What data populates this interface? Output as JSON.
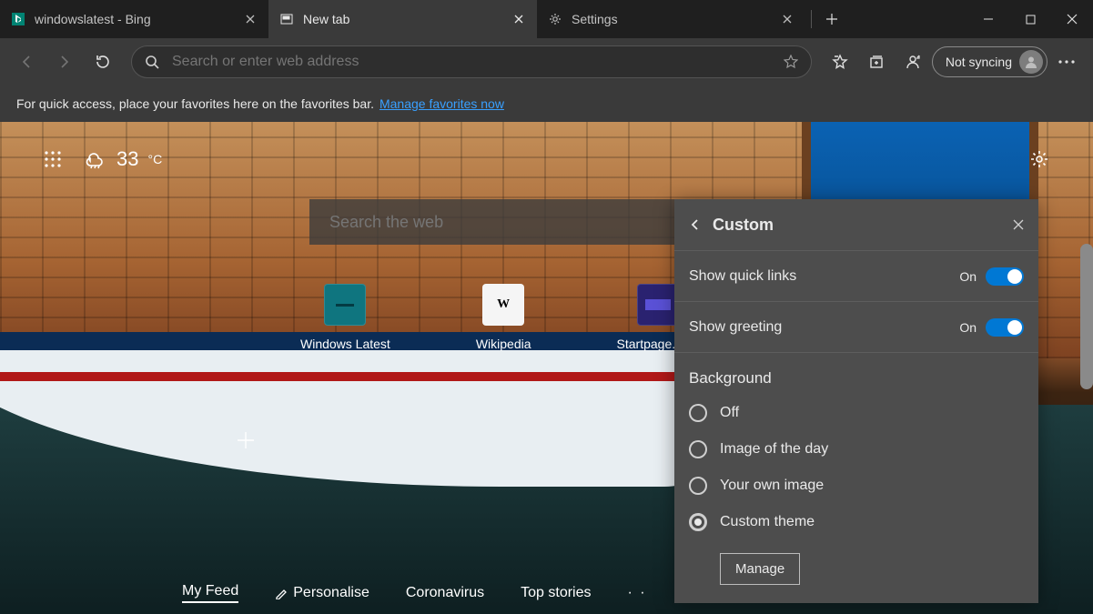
{
  "tabs": [
    {
      "title": "windowslatest - Bing",
      "icon": "bing"
    },
    {
      "title": "New tab",
      "icon": "ntp"
    },
    {
      "title": "Settings",
      "icon": "gear"
    }
  ],
  "omnibox": {
    "placeholder": "Search or enter web address",
    "sync_label": "Not syncing"
  },
  "favorites_bar": {
    "hint": "For quick access, place your favorites here on the favorites bar.",
    "link": "Manage favorites now"
  },
  "weather": {
    "temp": "33",
    "unit": "°C"
  },
  "ntp_search": {
    "placeholder": "Search the web"
  },
  "quick_links": [
    {
      "label": "Windows Latest",
      "glyph": "—"
    },
    {
      "label": "Wikipedia",
      "glyph": "W"
    },
    {
      "label": "Startpage.com",
      "glyph": ""
    }
  ],
  "feed": {
    "active": "My Feed",
    "items": [
      "My Feed",
      "Personalise",
      "Coronavirus",
      "Top stories"
    ]
  },
  "panel": {
    "title": "Custom",
    "rows": [
      {
        "label": "Show quick links",
        "state": "On"
      },
      {
        "label": "Show greeting",
        "state": "On"
      }
    ],
    "bg_section": "Background",
    "bg_options": [
      "Off",
      "Image of the day",
      "Your own image",
      "Custom theme"
    ],
    "bg_selected": "Custom theme",
    "manage": "Manage"
  }
}
